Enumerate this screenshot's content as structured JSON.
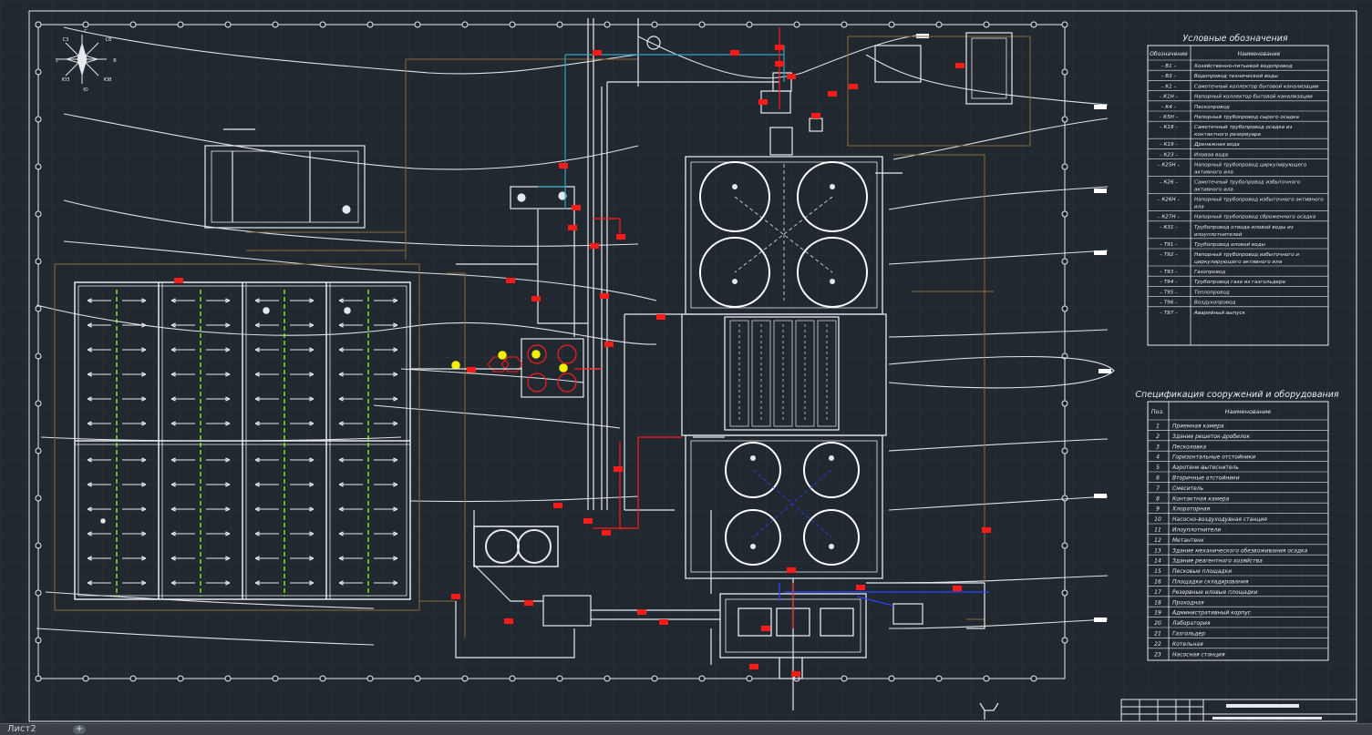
{
  "legend": {
    "title": "Условные обозначения",
    "col_code": "Обозначение",
    "col_name": "Наименование",
    "rows": [
      {
        "code": "– В1 –",
        "name": "Хозяйственно-питьевой водопровод"
      },
      {
        "code": "– В3 –",
        "name": "Водопровод технической воды"
      },
      {
        "code": "– К1 –",
        "name": "Самотечный коллектор бытовой канализации"
      },
      {
        "code": "– К1Н –",
        "name": "Напорный коллектор бытовой канализации"
      },
      {
        "code": "– К4 –",
        "name": "Пескопровод"
      },
      {
        "code": "– К5Н –",
        "name": "Напорный трубопровод сырого осадка"
      },
      {
        "code": "– К18 –",
        "name": "Самотечный трубопровод осадка из контактного резервуара"
      },
      {
        "code": "– К19 –",
        "name": "Дренажная вода"
      },
      {
        "code": "– К23 –",
        "name": "Иловая вода"
      },
      {
        "code": "– К25Н –",
        "name": "Напорный трубопровод циркулирующего активного ила"
      },
      {
        "code": "– К26 –",
        "name": "Самотечный трубопровод избыточного активного ила"
      },
      {
        "code": "– К26Н –",
        "name": "Напорный трубопровод избыточного активного ила"
      },
      {
        "code": "– К27Н –",
        "name": "Напорный трубопровод сброженного осадка"
      },
      {
        "code": "– К31 –",
        "name": "Трубопровод отвода иловой воды из илоуплотнителей"
      },
      {
        "code": "– Т91 –",
        "name": "Трубопровод иловой воды"
      },
      {
        "code": "– Т92 –",
        "name": "Напорный трубопровод избыточного и циркулирующего активного ила"
      },
      {
        "code": "– Т93 –",
        "name": "Газопровод"
      },
      {
        "code": "– Т94 –",
        "name": "Трубопровод газа из газгольдера"
      },
      {
        "code": "– Т95 –",
        "name": "Теплопровод"
      },
      {
        "code": "– Т96 –",
        "name": "Воздухопровод"
      },
      {
        "code": "– Т97 –",
        "name": "Аварийный выпуск"
      }
    ]
  },
  "spec": {
    "title": "Спецификация сооружений и оборудования",
    "col_pos": "Поз.",
    "col_name": "Наименование",
    "rows": [
      {
        "pos": "1",
        "name": "Приемная камера"
      },
      {
        "pos": "2",
        "name": "Здание решеток-дробилок"
      },
      {
        "pos": "3",
        "name": "Песколовка"
      },
      {
        "pos": "4",
        "name": "Горизонтальные отстойники"
      },
      {
        "pos": "5",
        "name": "Аэротенк-вытеснитель"
      },
      {
        "pos": "6",
        "name": "Вторичные отстойники"
      },
      {
        "pos": "7",
        "name": "Смеситель"
      },
      {
        "pos": "8",
        "name": "Контактная камера"
      },
      {
        "pos": "9",
        "name": "Хлораторная"
      },
      {
        "pos": "10",
        "name": "Насосно-воздуходувная станция"
      },
      {
        "pos": "11",
        "name": "Илоуплотнители"
      },
      {
        "pos": "12",
        "name": "Метантенк"
      },
      {
        "pos": "13",
        "name": "Здание механического обезвоживания осадка"
      },
      {
        "pos": "14",
        "name": "Здание реагентного хозяйства"
      },
      {
        "pos": "15",
        "name": "Песковые площадки"
      },
      {
        "pos": "16",
        "name": "Площадки складирования"
      },
      {
        "pos": "17",
        "name": "Резервные иловые площадки"
      },
      {
        "pos": "18",
        "name": "Проходная"
      },
      {
        "pos": "19",
        "name": "Административный корпус"
      },
      {
        "pos": "20",
        "name": "Лаборатория"
      },
      {
        "pos": "21",
        "name": "Газгольдер"
      },
      {
        "pos": "22",
        "name": "Котельная"
      },
      {
        "pos": "23",
        "name": "Насосная станция"
      }
    ]
  },
  "compass": {
    "n": "С",
    "ne": "СВ",
    "e": "В",
    "se": "ЮВ",
    "s": "Ю",
    "sw": "ЮЗ",
    "w": "З",
    "nw": "СЗ"
  },
  "status": {
    "sheet_tab": "Лист2",
    "add_sheet": "+"
  },
  "colors": {
    "background": "#212830",
    "lines": "#e6e9ec",
    "contours": "#8a6a3a",
    "accent_red": "#ff1a1a",
    "accent_cyan": "#2aa6c8",
    "accent_green": "#8cff2a",
    "accent_yellow": "#f5f000",
    "accent_blue": "#2b44ff"
  }
}
